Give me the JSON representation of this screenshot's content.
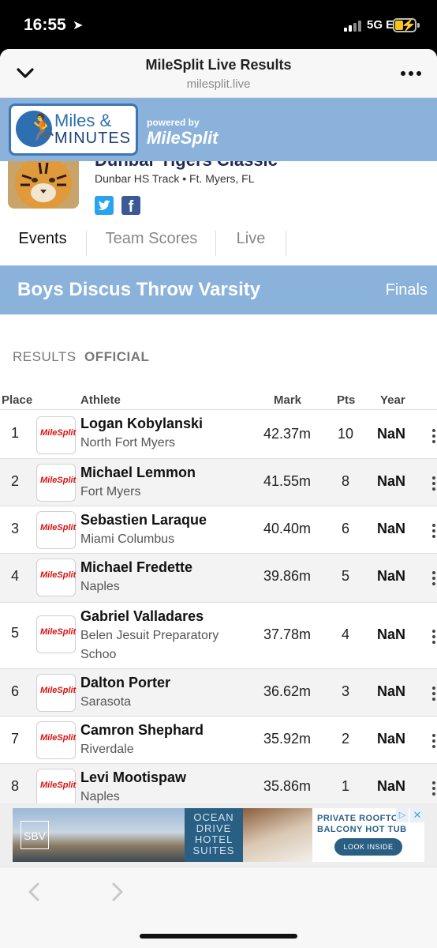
{
  "status_bar": {
    "time": "16:55",
    "network": "5G E"
  },
  "browser": {
    "title": "MileSplit Live Results",
    "url": "milesplit.live"
  },
  "banner": {
    "logo_line1": "Miles &",
    "logo_line2": "MINUTES",
    "powered_by": "powered by",
    "brand": "MileSplit"
  },
  "meet": {
    "title_partial": "Dunbar Tigers Classic",
    "location": "Dunbar HS Track • Ft. Myers, FL"
  },
  "tabs": [
    {
      "label": "Events",
      "active": true
    },
    {
      "label": "Team Scores",
      "active": false
    },
    {
      "label": "Live",
      "active": false
    }
  ],
  "event": {
    "name": "Boys Discus Throw Varsity",
    "round": "Finals"
  },
  "results": {
    "label": "RESULTS",
    "separator": "·",
    "status": "OFFICIAL"
  },
  "columns": {
    "place": "Place",
    "athlete": "Athlete",
    "mark": "Mark",
    "pts": "Pts",
    "year": "Year"
  },
  "team_logo_text": "MileSplit",
  "rows": [
    {
      "place": "1",
      "name": "Logan Kobylanski",
      "team": "North Fort Myers",
      "mark": "42.37m",
      "pts": "10",
      "year": "NaN"
    },
    {
      "place": "2",
      "name": "Michael Lemmon",
      "team": "Fort Myers",
      "mark": "41.55m",
      "pts": "8",
      "year": "NaN"
    },
    {
      "place": "3",
      "name": "Sebastien Laraque",
      "team": "Miami Columbus",
      "mark": "40.40m",
      "pts": "6",
      "year": "NaN"
    },
    {
      "place": "4",
      "name": "Michael Fredette",
      "team": "Naples",
      "mark": "39.86m",
      "pts": "5",
      "year": "NaN"
    },
    {
      "place": "5",
      "name": "Gabriel Valladares",
      "team": "Belen Jesuit Preparatory Schoo",
      "mark": "37.78m",
      "pts": "4",
      "year": "NaN"
    },
    {
      "place": "6",
      "name": "Dalton Porter",
      "team": "Sarasota",
      "mark": "36.62m",
      "pts": "3",
      "year": "NaN"
    },
    {
      "place": "7",
      "name": "Camron Shephard",
      "team": "Riverdale",
      "mark": "35.92m",
      "pts": "2",
      "year": "NaN"
    },
    {
      "place": "8",
      "name": "Levi Mootispaw",
      "team": "Naples",
      "mark": "35.86m",
      "pts": "1",
      "year": "NaN"
    }
  ],
  "ad": {
    "brand_mark": "SBV",
    "panel_text": "OCEAN DRIVE HOTEL SUITES",
    "headline": "PRIVATE ROOFTOP BALCONY HOT TUB",
    "cta": "LOOK INSIDE"
  },
  "colors": {
    "header_blue": "#8ab2db",
    "year_text": "#111111"
  }
}
